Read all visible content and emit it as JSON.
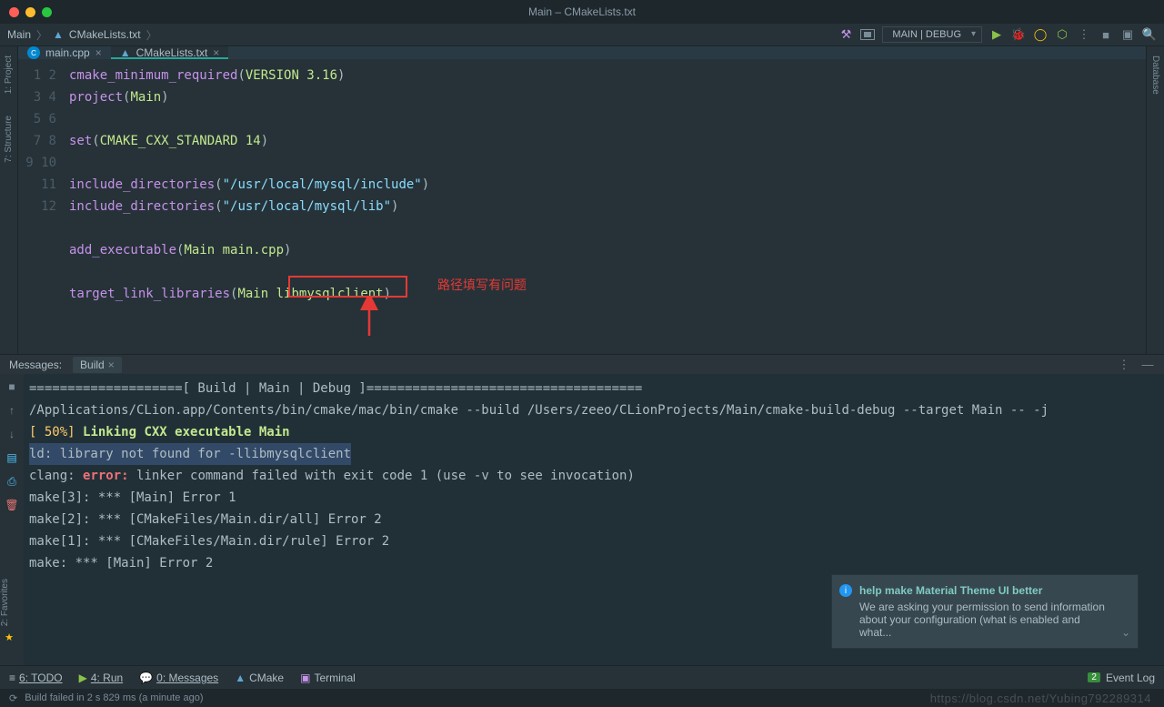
{
  "window": {
    "title": "Main – CMakeLists.txt"
  },
  "breadcrumb": {
    "root": "Main",
    "file": "CMakeLists.txt"
  },
  "run_config": {
    "label": "MAIN | DEBUG"
  },
  "tabs": [
    {
      "name": "main.cpp",
      "active": false
    },
    {
      "name": "CMakeLists.txt",
      "active": true
    }
  ],
  "left_rail": {
    "project": "1: Project",
    "structure": "7: Structure"
  },
  "right_rail": {
    "database": "Database"
  },
  "code": {
    "lines": [
      {
        "n": 1,
        "raw": "cmake_minimum_required(VERSION 3.16)"
      },
      {
        "n": 2,
        "raw": "project(Main)"
      },
      {
        "n": 3,
        "raw": ""
      },
      {
        "n": 4,
        "raw": "set(CMAKE_CXX_STANDARD 14)"
      },
      {
        "n": 5,
        "raw": ""
      },
      {
        "n": 6,
        "raw": "include_directories(\"/usr/local/mysql/include\")"
      },
      {
        "n": 7,
        "raw": "include_directories(\"/usr/local/mysql/lib\")"
      },
      {
        "n": 8,
        "raw": ""
      },
      {
        "n": 9,
        "raw": "add_executable(Main main.cpp)"
      },
      {
        "n": 10,
        "raw": ""
      },
      {
        "n": 11,
        "raw": "target_link_libraries(Main libmysqlclient)"
      },
      {
        "n": 12,
        "raw": ""
      }
    ]
  },
  "annotation": {
    "text": "路径填写有问题",
    "highlight": "libmysqlclient"
  },
  "messages": {
    "label": "Messages:",
    "tab": "Build",
    "lines": [
      "====================[ Build | Main | Debug ]====================================",
      "/Applications/CLion.app/Contents/bin/cmake/mac/bin/cmake --build /Users/zeeo/CLionProjects/Main/cmake-build-debug --target Main -- -j",
      "[ 50%] Linking CXX executable Main",
      "ld: library not found for -llibmysqlclient",
      "clang: error: linker command failed with exit code 1 (use -v to see invocation)",
      "make[3]: *** [Main] Error 1",
      "make[2]: *** [CMakeFiles/Main.dir/all] Error 2",
      "make[1]: *** [CMakeFiles/Main.dir/rule] Error 2",
      "make: *** [Main] Error 2"
    ]
  },
  "notification": {
    "title": "help make Material Theme UI better",
    "body": "We are asking your permission to send information about your configuration (what is enabled and what..."
  },
  "bottom_tabs": {
    "todo": "6: TODO",
    "run": "4: Run",
    "messages": "0: Messages",
    "cmake": "CMake",
    "terminal": "Terminal",
    "event_log": "Event Log",
    "event_count": "2"
  },
  "left_fav": {
    "favorites": "2: Favorites"
  },
  "status": {
    "text": "Build failed in 2 s 829 ms (a minute ago)",
    "watermark": "https://blog.csdn.net/Yubing792289314"
  }
}
